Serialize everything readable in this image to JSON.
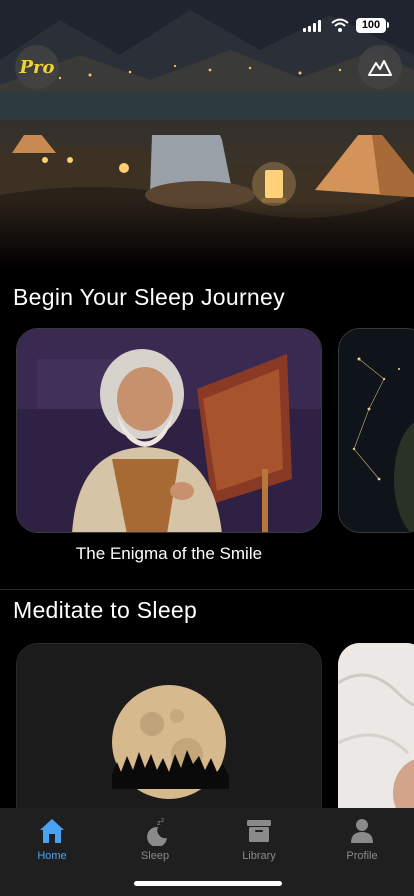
{
  "status_bar": {
    "time": "",
    "battery": "100"
  },
  "header": {
    "pro_label": "Pro",
    "scene_icon": "mountain-icon"
  },
  "sections": [
    {
      "title": "Begin Your Sleep Journey",
      "cards": [
        {
          "caption": "The Enigma of the Smile",
          "image": "old-painter"
        },
        {
          "caption": "",
          "image": "constellation"
        }
      ]
    },
    {
      "title": "Meditate to Sleep",
      "cards": [
        {
          "caption": "",
          "image": "full-moon"
        },
        {
          "caption": "",
          "image": "white-fabric"
        }
      ]
    }
  ],
  "tabs": [
    {
      "label": "Home",
      "icon": "home-icon",
      "active": true
    },
    {
      "label": "Sleep",
      "icon": "moon-zzz-icon",
      "active": false
    },
    {
      "label": "Library",
      "icon": "archive-box-icon",
      "active": false
    },
    {
      "label": "Profile",
      "icon": "person-icon",
      "active": false
    }
  ],
  "colors": {
    "accent": "#4aa3f2",
    "pro_gold": "#f2d23a",
    "tabbar_bg": "#1f1f1f",
    "inactive_tab": "#8a8a8a"
  }
}
